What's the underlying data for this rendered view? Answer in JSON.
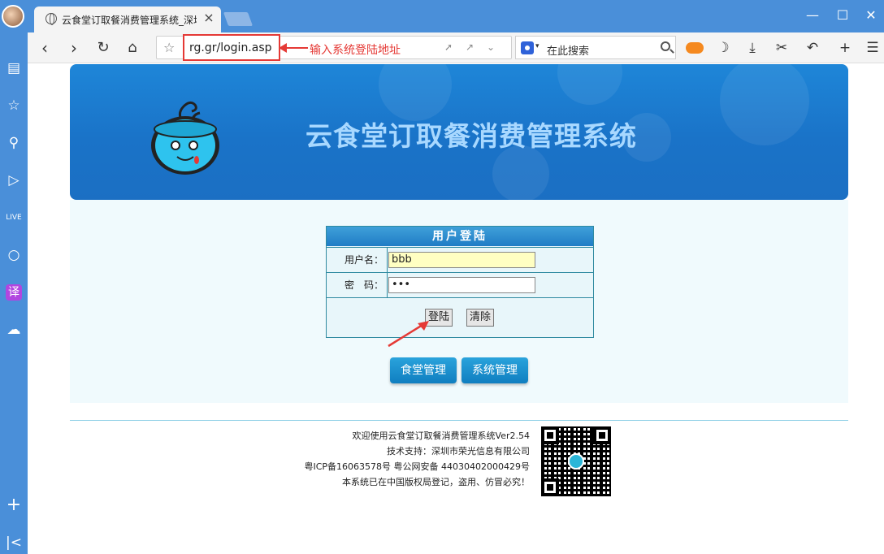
{
  "browser": {
    "tab_title": "云食堂订取餐消费管理系统_深圳",
    "tab_close": "×",
    "url": "rg.gr/login.asp",
    "url_annotation": "输入系统登陆地址",
    "search_placeholder": "在此搜索"
  },
  "banner": {
    "title": "云食堂订取餐消费管理系统"
  },
  "login": {
    "header": "用户登陆",
    "username_label": "用户名：",
    "username_value": "bbb",
    "password_label": "密　码：",
    "password_value": "•••",
    "login_button": "登陆",
    "clear_button": "清除"
  },
  "nav_buttons": {
    "canteen": "食堂管理",
    "system": "系统管理"
  },
  "footer": {
    "line1": "欢迎使用云食堂订取餐消费管理系统Ver2.54",
    "line2": "技术支持：深圳市荣光信息有限公司",
    "line3": "粤ICP备16063578号  粤公网安备 44030402000429号",
    "line4": "本系统已在中国版权局登记，盗用、仿冒必究！"
  },
  "colors": {
    "accent": "#4a8fd9",
    "annotation_red": "#e53935",
    "banner_blue": "#1a73c8",
    "button_blue": "#0f7ec0"
  },
  "icons": {
    "sidebar": [
      "news-icon",
      "star-icon",
      "search-icon",
      "video-icon",
      "live-icon",
      "chat-icon",
      "translate-icon",
      "cart-icon",
      "plus-icon",
      "collapse-icon"
    ]
  }
}
